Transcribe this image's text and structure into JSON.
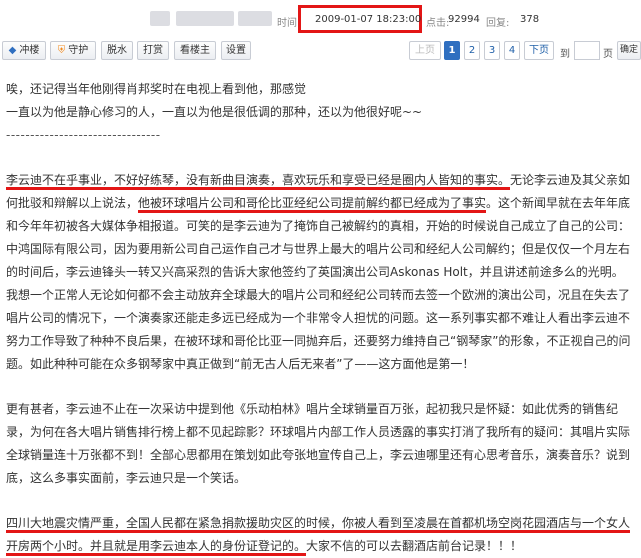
{
  "meta": {
    "time_label": "时间",
    "time_value": "2009-01-07 18:23:00",
    "clicks_label": "点击:",
    "clicks_value": "92994",
    "replies_label": "回复:",
    "replies_value": "378"
  },
  "toolbar": {
    "top_label": "冲楼",
    "guard_label": "守护",
    "water_label": "脱水",
    "reward_label": "打赏",
    "owner_label": "看楼主",
    "settings_label": "设置"
  },
  "pagination": {
    "prev_label": "上页",
    "pages": [
      "1",
      "2",
      "3",
      "4"
    ],
    "next_label": "下页",
    "goto_label": "到",
    "page_suffix": "页",
    "confirm_label": "确定"
  },
  "post": {
    "line1": "唉，还记得当年他刚得肖邦奖时在电视上看到他，那感觉",
    "line2": "一直以为他是静心修习的人，一直以为他是很低调的那种，还以为他很好呢~~",
    "separator": "--------------------------------",
    "p1_a": "李云迪不在乎事业，不好好练琴，没有新曲目演奏，喜欢玩乐和享受已经是圈内人皆知的事实。",
    "p1_b": "无论李云迪及其父亲如何批驳和辩解以上说法，",
    "p1_c": "他被环球唱片公司和哥伦比亚经纪公司提前解约都已经成为了事实",
    "p1_d": "。这个新闻早就在去年年底和今年年初被各大媒体争相报道。可笑的是李云迪为了掩饰自己被解约的真相，开始的时候说自己成立了自己的公司：中鸿国际有限公司，因为要用新公司自己运作自己才与世界上最大的唱片公司和经纪人公司解约；但是仅仅一个月左右的时间后，李云迪锋头一转又兴高采烈的告诉大家他签约了英国演出公司Askonas Holt，并且讲述前途多么的光明。我想一个正常人无论如何都不会主动放弃全球最大的唱片公司和经纪公司转而去签一个欧洲的演出公司，况且在失去了唱片公司的情况下，一个演奏家还能走多远已经成为一个非常令人担忧的问题。这一系列事实都不难让人看出李云迪不努力工作导致了种种不良后果，在被环球和哥伦比亚一同抛弃后，还要努力维持自己“钢琴家”的形象，不正视自己的问题。如此种种可能在众多钢琴家中真正做到“前无古人后无来者”了——这方面他是第一！",
    "p2": "更有甚者，李云迪不止在一次采访中提到他《乐动柏林》唱片全球销量百万张，起初我只是怀疑：如此优秀的销售纪录，为何在各大唱片销售排行榜上都不见起踪影？环球唱片内部工作人员透露的事实打消了我所有的疑问：其唱片实际全球销量连十万张都不到！全部心思都用在策划如此夸张地宣传自己上，李云迪哪里还有心思考音乐，演奏音乐？说到底，这么多事实面前，李云迪只是一个笑话。",
    "p3_a": "四川大地震灾情严重，全国人民都在紧急捐款援助灾区的时候，你被人看到至凌晨在首都机场空岗花园酒店与一个女人开房两个小时。并且就是用李云迪本人的身份证登记的。",
    "p3_b": "大家不信的可以去翻酒店前台记录！！！"
  }
}
